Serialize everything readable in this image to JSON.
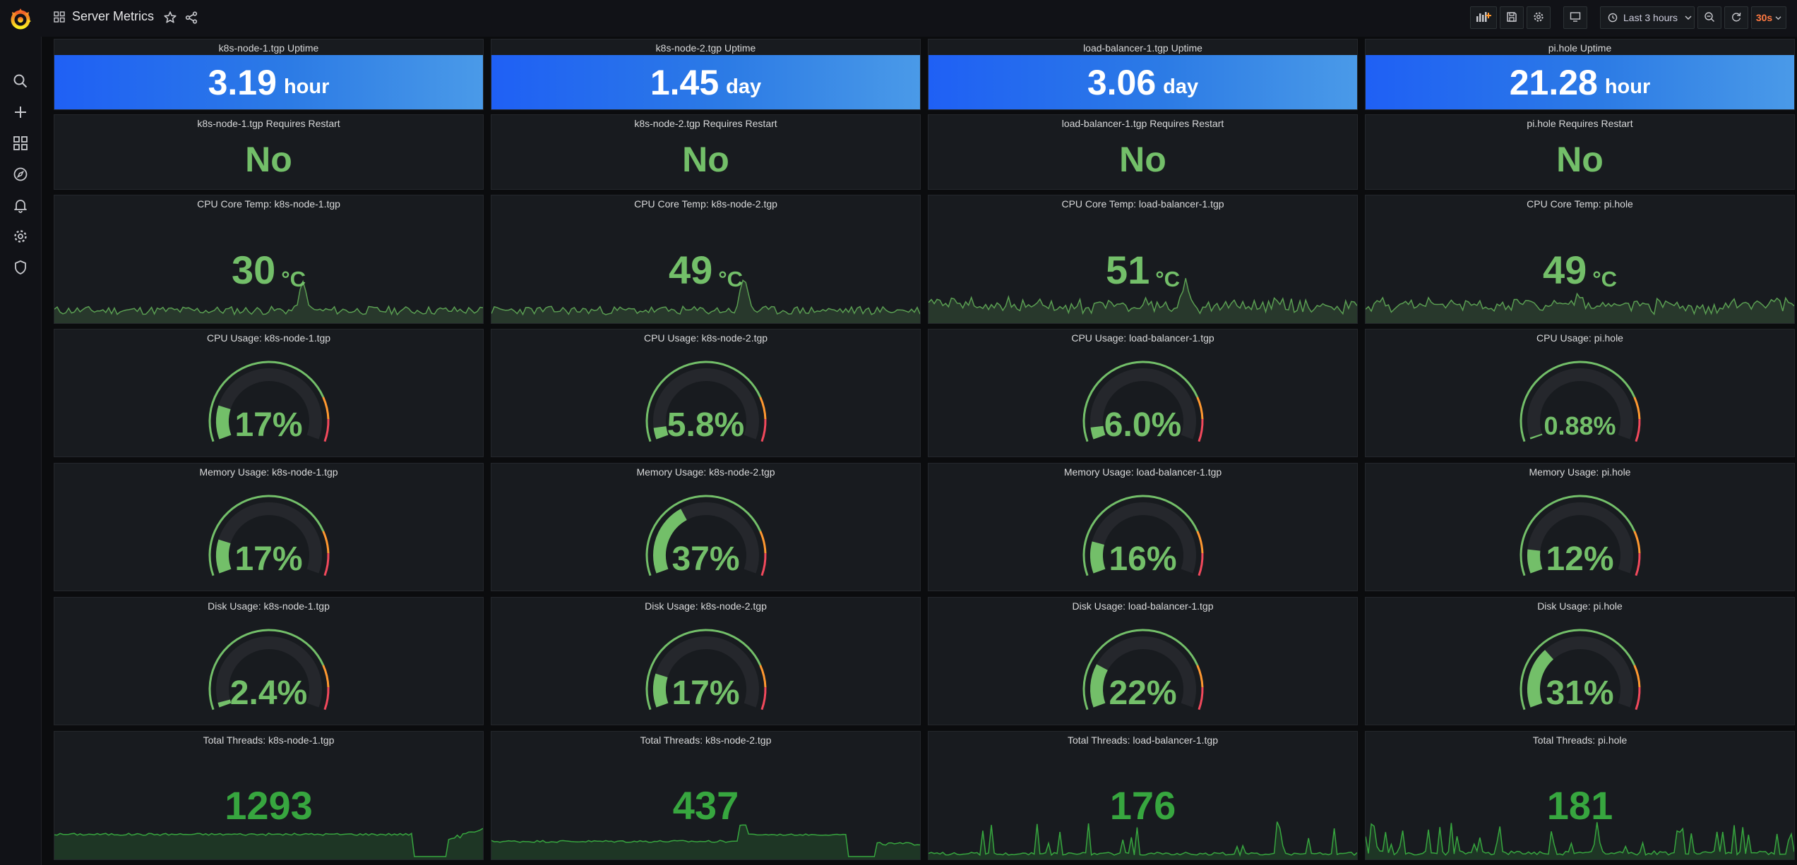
{
  "app": {
    "title": "Server Metrics"
  },
  "toolbar": {
    "time_range": "Last 3 hours",
    "refresh_interval": "30s",
    "icons": [
      "add-panel-icon",
      "save-dashboard-icon",
      "dashboard-settings-icon",
      "cycle-view-mode-icon",
      "clock-icon",
      "zoom-out-icon",
      "refresh-icon"
    ]
  },
  "sidebar": {
    "icons": [
      "grafana-logo",
      "search-icon",
      "plus-icon",
      "dashboards-icon",
      "explore-icon",
      "alerting-icon",
      "configuration-icon",
      "server-admin-icon"
    ]
  },
  "colors": {
    "ok_green": "#73bf69",
    "uptime_blue": "#1f60f5",
    "threshold_orange": "#ff9830",
    "threshold_red": "#f2495c",
    "refresh_orange": "#ff7941"
  },
  "rows": {
    "uptime": [
      {
        "title": "k8s-node-1.tgp Uptime",
        "value": "3.19",
        "unit": "hour"
      },
      {
        "title": "k8s-node-2.tgp Uptime",
        "value": "1.45",
        "unit": "day"
      },
      {
        "title": "load-balancer-1.tgp Uptime",
        "value": "3.06",
        "unit": "day"
      },
      {
        "title": "pi.hole Uptime",
        "value": "21.28",
        "unit": "hour"
      }
    ],
    "restart": [
      {
        "title": "k8s-node-1.tgp Requires Restart",
        "value": "No"
      },
      {
        "title": "k8s-node-2.tgp Requires Restart",
        "value": "No"
      },
      {
        "title": "load-balancer-1.tgp Requires Restart",
        "value": "No"
      },
      {
        "title": "pi.hole Requires Restart",
        "value": "No"
      }
    ],
    "temp": [
      {
        "title": "CPU Core Temp: k8s-node-1.tgp",
        "value": "30",
        "unit": "°C"
      },
      {
        "title": "CPU Core Temp: k8s-node-2.tgp",
        "value": "49",
        "unit": "°C"
      },
      {
        "title": "CPU Core Temp: load-balancer-1.tgp",
        "value": "51",
        "unit": "°C"
      },
      {
        "title": "CPU Core Temp: pi.hole",
        "value": "49",
        "unit": "°C"
      }
    ],
    "cpu": [
      {
        "title": "CPU Usage: k8s-node-1.tgp",
        "display": "17%",
        "percent": 17
      },
      {
        "title": "CPU Usage: k8s-node-2.tgp",
        "display": "5.8%",
        "percent": 5.8
      },
      {
        "title": "CPU Usage: load-balancer-1.tgp",
        "display": "6.0%",
        "percent": 6.0
      },
      {
        "title": "CPU Usage: pi.hole",
        "display": "0.88%",
        "percent": 0.88
      }
    ],
    "memory": [
      {
        "title": "Memory Usage: k8s-node-1.tgp",
        "display": "17%",
        "percent": 17
      },
      {
        "title": "Memory Usage: k8s-node-2.tgp",
        "display": "37%",
        "percent": 37
      },
      {
        "title": "Memory Usage: load-balancer-1.tgp",
        "display": "16%",
        "percent": 16
      },
      {
        "title": "Memory Usage: pi.hole",
        "display": "12%",
        "percent": 12
      }
    ],
    "disk": [
      {
        "title": "Disk Usage: k8s-node-1.tgp",
        "display": "2.4%",
        "percent": 2.4
      },
      {
        "title": "Disk Usage: k8s-node-2.tgp",
        "display": "17%",
        "percent": 17
      },
      {
        "title": "Disk Usage: load-balancer-1.tgp",
        "display": "22%",
        "percent": 22
      },
      {
        "title": "Disk Usage: pi.hole",
        "display": "31%",
        "percent": 31
      }
    ],
    "threads": [
      {
        "title": "Total Threads: k8s-node-1.tgp",
        "value": "1293"
      },
      {
        "title": "Total Threads: k8s-node-2.tgp",
        "value": "437"
      },
      {
        "title": "Total Threads: load-balancer-1.tgp",
        "value": "176"
      },
      {
        "title": "Total Threads: pi.hole",
        "value": "181"
      }
    ]
  }
}
